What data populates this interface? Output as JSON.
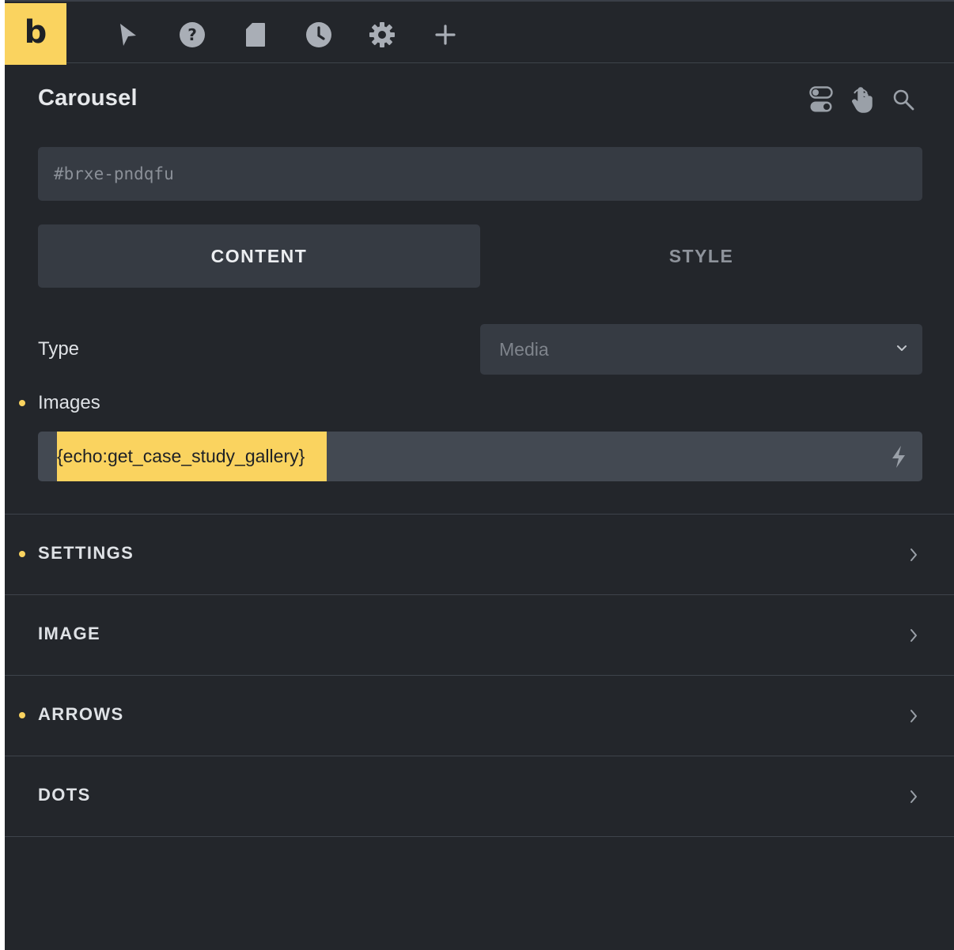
{
  "topbar": {
    "logo": "b",
    "icons": [
      "cursor-icon",
      "help-icon",
      "page-icon",
      "history-icon",
      "settings-icon",
      "add-icon"
    ]
  },
  "panel": {
    "title": "Carousel",
    "header_icons": [
      "toggle-icon",
      "pointer-hand-icon",
      "search-icon"
    ],
    "element_id": "#brxe-pndqfu",
    "tabs": [
      {
        "label": "CONTENT",
        "active": true
      },
      {
        "label": "STYLE",
        "active": false
      }
    ],
    "type": {
      "label": "Type",
      "value": "Media"
    },
    "images": {
      "label": "Images",
      "value": "{echo:get_case_study_gallery}"
    },
    "sections": [
      {
        "label": "SETTINGS",
        "modified": true
      },
      {
        "label": "IMAGE",
        "modified": false
      },
      {
        "label": "ARROWS",
        "modified": true
      },
      {
        "label": "DOTS",
        "modified": false
      }
    ]
  },
  "colors": {
    "accent": "#fad35f",
    "panel_bg": "#23262b",
    "input_bg": "#363b43"
  }
}
